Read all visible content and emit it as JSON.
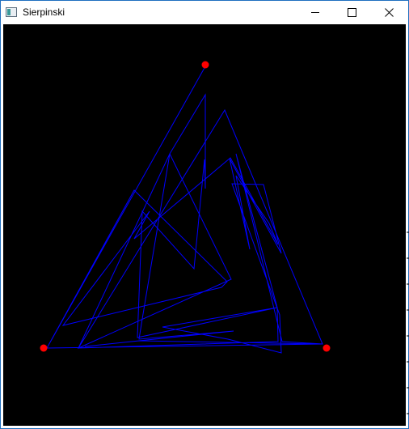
{
  "window": {
    "title": "Sierpinski",
    "app_icon": "window-app-icon",
    "controls": {
      "minimize_icon": "minimize-icon",
      "maximize_icon": "maximize-icon",
      "close_icon": "close-icon"
    }
  },
  "canvas": {
    "background_color": "#000000",
    "vertex_color": "#ff0000",
    "path_color": "#0000ff"
  }
}
